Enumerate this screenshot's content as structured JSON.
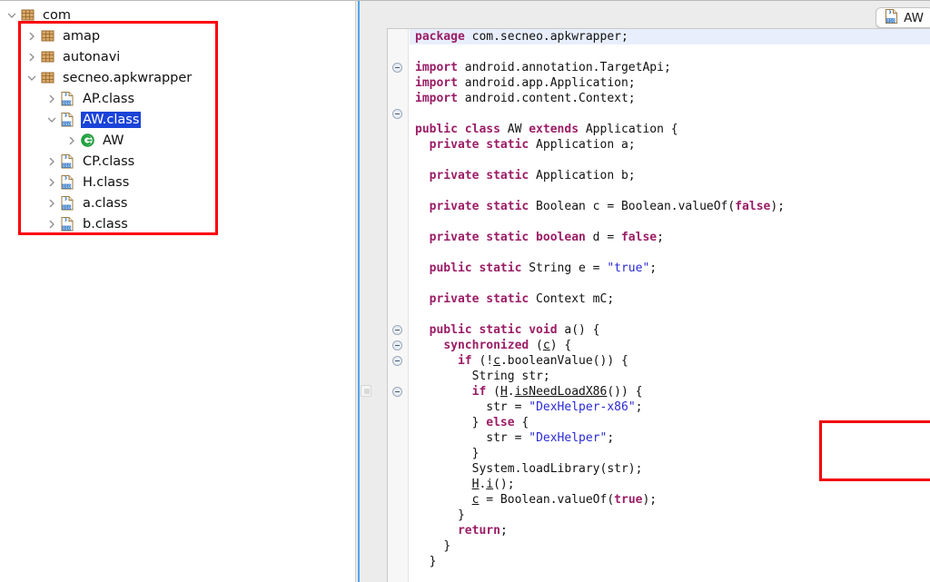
{
  "sidebar": {
    "name": "project-explorer",
    "tree": [
      {
        "label": "com",
        "level": 0,
        "icon": "package-icon",
        "twisty": "expanded",
        "selected": false
      },
      {
        "label": "amap",
        "level": 1,
        "icon": "package-icon",
        "twisty": "collapsed",
        "selected": false
      },
      {
        "label": "autonavi",
        "level": 1,
        "icon": "package-icon",
        "twisty": "collapsed",
        "selected": false
      },
      {
        "label": "secneo.apkwrapper",
        "level": 1,
        "icon": "package-icon",
        "twisty": "expanded",
        "selected": false
      },
      {
        "label": "AP.class",
        "level": 2,
        "icon": "class-file-icon",
        "twisty": "collapsed",
        "selected": false
      },
      {
        "label": "AW.class",
        "level": 2,
        "icon": "class-file-icon",
        "twisty": "expanded",
        "selected": true
      },
      {
        "label": "AW",
        "level": 3,
        "icon": "java-class-icon",
        "twisty": "collapsed",
        "selected": false
      },
      {
        "label": "CP.class",
        "level": 2,
        "icon": "class-file-icon",
        "twisty": "collapsed",
        "selected": false
      },
      {
        "label": "H.class",
        "level": 2,
        "icon": "class-file-icon",
        "twisty": "collapsed",
        "selected": false
      },
      {
        "label": "a.class",
        "level": 2,
        "icon": "class-file-icon",
        "twisty": "collapsed",
        "selected": false
      },
      {
        "label": "b.class",
        "level": 2,
        "icon": "class-file-icon",
        "twisty": "collapsed",
        "selected": false
      }
    ],
    "annotation": {
      "shape": "rectangle",
      "color": "#fb0007"
    }
  },
  "editor": {
    "tab": {
      "label": "AW",
      "icon": "class-file-icon"
    },
    "current_line_index": 0,
    "fold_marker_lines": [
      2,
      5,
      19,
      20,
      21,
      23
    ],
    "annotation": {
      "shape": "rectangle",
      "color": "#f10007"
    },
    "lines": [
      {
        "indent": 0,
        "tokens": [
          {
            "t": "kw",
            "v": "package"
          },
          {
            "t": "plain",
            "v": " com.secneo.apkwrapper;"
          }
        ],
        "current": true
      },
      {
        "indent": 0,
        "tokens": []
      },
      {
        "indent": 0,
        "tokens": [
          {
            "t": "kw",
            "v": "import"
          },
          {
            "t": "plain",
            "v": " android.annotation.TargetApi;"
          }
        ]
      },
      {
        "indent": 0,
        "tokens": [
          {
            "t": "kw",
            "v": "import"
          },
          {
            "t": "plain",
            "v": " android.app.Application;"
          }
        ]
      },
      {
        "indent": 0,
        "tokens": [
          {
            "t": "kw",
            "v": "import"
          },
          {
            "t": "plain",
            "v": " android.content.Context;"
          }
        ]
      },
      {
        "indent": 0,
        "tokens": []
      },
      {
        "indent": 0,
        "tokens": [
          {
            "t": "kw",
            "v": "public class"
          },
          {
            "t": "plain",
            "v": " AW "
          },
          {
            "t": "kw",
            "v": "extends"
          },
          {
            "t": "plain",
            "v": " Application {"
          }
        ]
      },
      {
        "indent": 1,
        "tokens": [
          {
            "t": "kw",
            "v": "private static"
          },
          {
            "t": "plain",
            "v": " Application a;"
          }
        ]
      },
      {
        "indent": 0,
        "tokens": []
      },
      {
        "indent": 1,
        "tokens": [
          {
            "t": "kw",
            "v": "private static"
          },
          {
            "t": "plain",
            "v": " Application b;"
          }
        ]
      },
      {
        "indent": 0,
        "tokens": []
      },
      {
        "indent": 1,
        "tokens": [
          {
            "t": "kw",
            "v": "private static"
          },
          {
            "t": "plain",
            "v": " Boolean c = Boolean.valueOf("
          },
          {
            "t": "kw",
            "v": "false"
          },
          {
            "t": "plain",
            "v": ");"
          }
        ]
      },
      {
        "indent": 0,
        "tokens": []
      },
      {
        "indent": 1,
        "tokens": [
          {
            "t": "kw",
            "v": "private static boolean"
          },
          {
            "t": "plain",
            "v": " d = "
          },
          {
            "t": "kw",
            "v": "false"
          },
          {
            "t": "plain",
            "v": ";"
          }
        ]
      },
      {
        "indent": 0,
        "tokens": []
      },
      {
        "indent": 1,
        "tokens": [
          {
            "t": "kw",
            "v": "public static"
          },
          {
            "t": "plain",
            "v": " String e = "
          },
          {
            "t": "str",
            "v": "\"true\""
          },
          {
            "t": "plain",
            "v": ";"
          }
        ]
      },
      {
        "indent": 0,
        "tokens": []
      },
      {
        "indent": 1,
        "tokens": [
          {
            "t": "kw",
            "v": "private static"
          },
          {
            "t": "plain",
            "v": " Context mC;"
          }
        ]
      },
      {
        "indent": 0,
        "tokens": []
      },
      {
        "indent": 1,
        "tokens": [
          {
            "t": "kw",
            "v": "public static void"
          },
          {
            "t": "plain",
            "v": " a() {"
          }
        ]
      },
      {
        "indent": 2,
        "tokens": [
          {
            "t": "kw",
            "v": "synchronized"
          },
          {
            "t": "plain",
            "v": " ("
          },
          {
            "t": "ul",
            "v": "c"
          },
          {
            "t": "plain",
            "v": ") {"
          }
        ]
      },
      {
        "indent": 3,
        "tokens": [
          {
            "t": "kw",
            "v": "if"
          },
          {
            "t": "plain",
            "v": " (!"
          },
          {
            "t": "ul",
            "v": "c"
          },
          {
            "t": "plain",
            "v": ".booleanValue()) {"
          }
        ]
      },
      {
        "indent": 4,
        "tokens": [
          {
            "t": "plain",
            "v": "String str;"
          }
        ]
      },
      {
        "indent": 4,
        "tokens": [
          {
            "t": "kw",
            "v": "if"
          },
          {
            "t": "plain",
            "v": " ("
          },
          {
            "t": "ul",
            "v": "H"
          },
          {
            "t": "plain",
            "v": "."
          },
          {
            "t": "ul",
            "v": "isNeedLoadX86"
          },
          {
            "t": "plain",
            "v": "()) {"
          }
        ]
      },
      {
        "indent": 5,
        "tokens": [
          {
            "t": "plain",
            "v": "str = "
          },
          {
            "t": "str",
            "v": "\"DexHelper-x86\""
          },
          {
            "t": "plain",
            "v": ";"
          }
        ]
      },
      {
        "indent": 4,
        "tokens": [
          {
            "t": "plain",
            "v": "} "
          },
          {
            "t": "kw",
            "v": "else"
          },
          {
            "t": "plain",
            "v": " {"
          }
        ]
      },
      {
        "indent": 5,
        "tokens": [
          {
            "t": "plain",
            "v": "str = "
          },
          {
            "t": "str",
            "v": "\"DexHelper\""
          },
          {
            "t": "plain",
            "v": ";"
          }
        ]
      },
      {
        "indent": 4,
        "tokens": [
          {
            "t": "plain",
            "v": "}"
          }
        ]
      },
      {
        "indent": 4,
        "tokens": [
          {
            "t": "plain",
            "v": "System.loadLibrary(str);"
          }
        ]
      },
      {
        "indent": 4,
        "tokens": [
          {
            "t": "ul",
            "v": "H"
          },
          {
            "t": "plain",
            "v": "."
          },
          {
            "t": "ul",
            "v": "i"
          },
          {
            "t": "plain",
            "v": "();"
          }
        ]
      },
      {
        "indent": 4,
        "tokens": [
          {
            "t": "ul",
            "v": "c"
          },
          {
            "t": "plain",
            "v": " = Boolean.valueOf("
          },
          {
            "t": "kw",
            "v": "true"
          },
          {
            "t": "plain",
            "v": ");"
          }
        ]
      },
      {
        "indent": 3,
        "tokens": [
          {
            "t": "plain",
            "v": "}"
          }
        ]
      },
      {
        "indent": 3,
        "tokens": [
          {
            "t": "kw",
            "v": "return"
          },
          {
            "t": "plain",
            "v": ";"
          }
        ]
      },
      {
        "indent": 2,
        "tokens": [
          {
            "t": "plain",
            "v": "}"
          }
        ]
      },
      {
        "indent": 1,
        "tokens": [
          {
            "t": "plain",
            "v": "}"
          }
        ]
      }
    ]
  }
}
